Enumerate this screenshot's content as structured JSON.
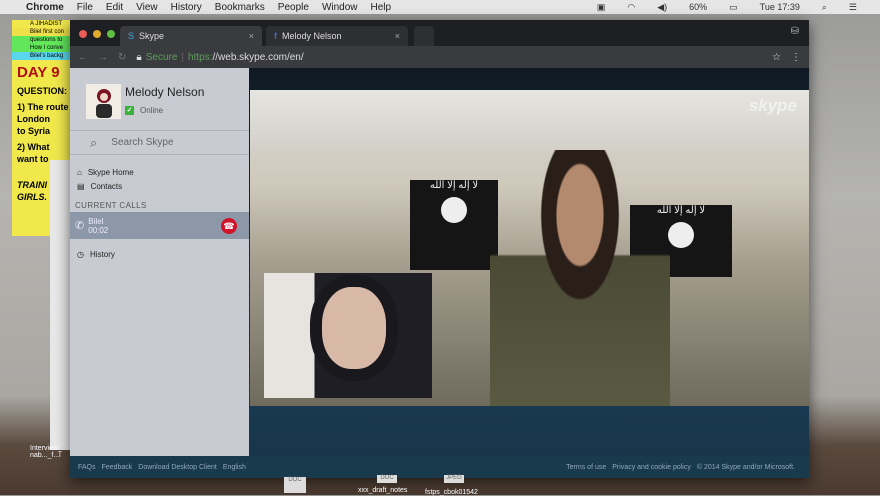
{
  "menubar": {
    "app": "Chrome",
    "items": [
      "File",
      "Edit",
      "View",
      "History",
      "Bookmarks",
      "People",
      "Window",
      "Help"
    ],
    "battery": "60%",
    "clock": "Tue 17:39"
  },
  "sticky": {
    "rows": [
      "A JIHADIST",
      "Bilel first con",
      "questions to",
      "How I conve",
      "Bilel's backg"
    ],
    "title": "DAY 9",
    "lines": [
      "QUESTION:",
      "1) The route",
      "London",
      "to Syria",
      "2) What",
      "want to",
      "TRAINI",
      "GIRLS."
    ]
  },
  "browser": {
    "tabs": [
      {
        "label": "Skype"
      },
      {
        "label": "Melody Nelson"
      }
    ],
    "secure": "Secure",
    "url_scheme": "https:",
    "url_rest": "//web.skype.com/en/"
  },
  "skype": {
    "user": "Melody Nelson",
    "status": "Online",
    "search_placeholder": "Search Skype",
    "nav": [
      "Skype Home",
      "Contacts"
    ],
    "current_calls_header": "CURRENT CALLS",
    "call": {
      "name": "Bilel",
      "duration": "00:02"
    },
    "history": "History",
    "logo": "skype",
    "flag_text": "لا إله إلا الله"
  },
  "footer": {
    "left": [
      "FAQs",
      "Feedback",
      "Download Desktop Client",
      "English"
    ],
    "right": [
      "Terms of use",
      "Privacy and cookie policy",
      "© 2014 Skype and/or Microsoft."
    ]
  },
  "desktop": {
    "files": [
      "xxx_draft_notes",
      "fstps_cbok01542"
    ],
    "file_types": [
      "DOC",
      "DOC",
      "JPEG"
    ],
    "labels": [
      "Interview_",
      "nab..._f...l"
    ]
  }
}
